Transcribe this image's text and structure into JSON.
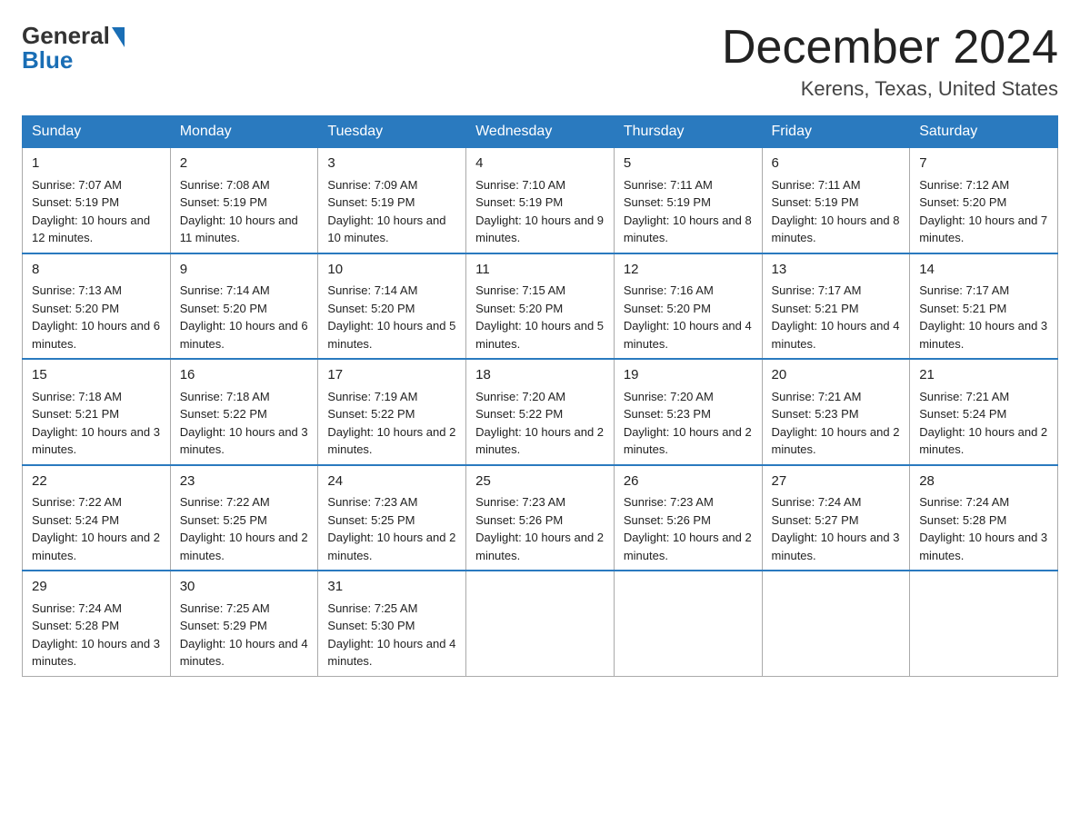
{
  "logo": {
    "general": "General",
    "blue": "Blue"
  },
  "title": "December 2024",
  "location": "Kerens, Texas, United States",
  "days_of_week": [
    "Sunday",
    "Monday",
    "Tuesday",
    "Wednesday",
    "Thursday",
    "Friday",
    "Saturday"
  ],
  "weeks": [
    [
      {
        "day": "1",
        "sunrise": "7:07 AM",
        "sunset": "5:19 PM",
        "daylight": "10 hours and 12 minutes."
      },
      {
        "day": "2",
        "sunrise": "7:08 AM",
        "sunset": "5:19 PM",
        "daylight": "10 hours and 11 minutes."
      },
      {
        "day": "3",
        "sunrise": "7:09 AM",
        "sunset": "5:19 PM",
        "daylight": "10 hours and 10 minutes."
      },
      {
        "day": "4",
        "sunrise": "7:10 AM",
        "sunset": "5:19 PM",
        "daylight": "10 hours and 9 minutes."
      },
      {
        "day": "5",
        "sunrise": "7:11 AM",
        "sunset": "5:19 PM",
        "daylight": "10 hours and 8 minutes."
      },
      {
        "day": "6",
        "sunrise": "7:11 AM",
        "sunset": "5:19 PM",
        "daylight": "10 hours and 8 minutes."
      },
      {
        "day": "7",
        "sunrise": "7:12 AM",
        "sunset": "5:20 PM",
        "daylight": "10 hours and 7 minutes."
      }
    ],
    [
      {
        "day": "8",
        "sunrise": "7:13 AM",
        "sunset": "5:20 PM",
        "daylight": "10 hours and 6 minutes."
      },
      {
        "day": "9",
        "sunrise": "7:14 AM",
        "sunset": "5:20 PM",
        "daylight": "10 hours and 6 minutes."
      },
      {
        "day": "10",
        "sunrise": "7:14 AM",
        "sunset": "5:20 PM",
        "daylight": "10 hours and 5 minutes."
      },
      {
        "day": "11",
        "sunrise": "7:15 AM",
        "sunset": "5:20 PM",
        "daylight": "10 hours and 5 minutes."
      },
      {
        "day": "12",
        "sunrise": "7:16 AM",
        "sunset": "5:20 PM",
        "daylight": "10 hours and 4 minutes."
      },
      {
        "day": "13",
        "sunrise": "7:17 AM",
        "sunset": "5:21 PM",
        "daylight": "10 hours and 4 minutes."
      },
      {
        "day": "14",
        "sunrise": "7:17 AM",
        "sunset": "5:21 PM",
        "daylight": "10 hours and 3 minutes."
      }
    ],
    [
      {
        "day": "15",
        "sunrise": "7:18 AM",
        "sunset": "5:21 PM",
        "daylight": "10 hours and 3 minutes."
      },
      {
        "day": "16",
        "sunrise": "7:18 AM",
        "sunset": "5:22 PM",
        "daylight": "10 hours and 3 minutes."
      },
      {
        "day": "17",
        "sunrise": "7:19 AM",
        "sunset": "5:22 PM",
        "daylight": "10 hours and 2 minutes."
      },
      {
        "day": "18",
        "sunrise": "7:20 AM",
        "sunset": "5:22 PM",
        "daylight": "10 hours and 2 minutes."
      },
      {
        "day": "19",
        "sunrise": "7:20 AM",
        "sunset": "5:23 PM",
        "daylight": "10 hours and 2 minutes."
      },
      {
        "day": "20",
        "sunrise": "7:21 AM",
        "sunset": "5:23 PM",
        "daylight": "10 hours and 2 minutes."
      },
      {
        "day": "21",
        "sunrise": "7:21 AM",
        "sunset": "5:24 PM",
        "daylight": "10 hours and 2 minutes."
      }
    ],
    [
      {
        "day": "22",
        "sunrise": "7:22 AM",
        "sunset": "5:24 PM",
        "daylight": "10 hours and 2 minutes."
      },
      {
        "day": "23",
        "sunrise": "7:22 AM",
        "sunset": "5:25 PM",
        "daylight": "10 hours and 2 minutes."
      },
      {
        "day": "24",
        "sunrise": "7:23 AM",
        "sunset": "5:25 PM",
        "daylight": "10 hours and 2 minutes."
      },
      {
        "day": "25",
        "sunrise": "7:23 AM",
        "sunset": "5:26 PM",
        "daylight": "10 hours and 2 minutes."
      },
      {
        "day": "26",
        "sunrise": "7:23 AM",
        "sunset": "5:26 PM",
        "daylight": "10 hours and 2 minutes."
      },
      {
        "day": "27",
        "sunrise": "7:24 AM",
        "sunset": "5:27 PM",
        "daylight": "10 hours and 3 minutes."
      },
      {
        "day": "28",
        "sunrise": "7:24 AM",
        "sunset": "5:28 PM",
        "daylight": "10 hours and 3 minutes."
      }
    ],
    [
      {
        "day": "29",
        "sunrise": "7:24 AM",
        "sunset": "5:28 PM",
        "daylight": "10 hours and 3 minutes."
      },
      {
        "day": "30",
        "sunrise": "7:25 AM",
        "sunset": "5:29 PM",
        "daylight": "10 hours and 4 minutes."
      },
      {
        "day": "31",
        "sunrise": "7:25 AM",
        "sunset": "5:30 PM",
        "daylight": "10 hours and 4 minutes."
      },
      null,
      null,
      null,
      null
    ]
  ]
}
